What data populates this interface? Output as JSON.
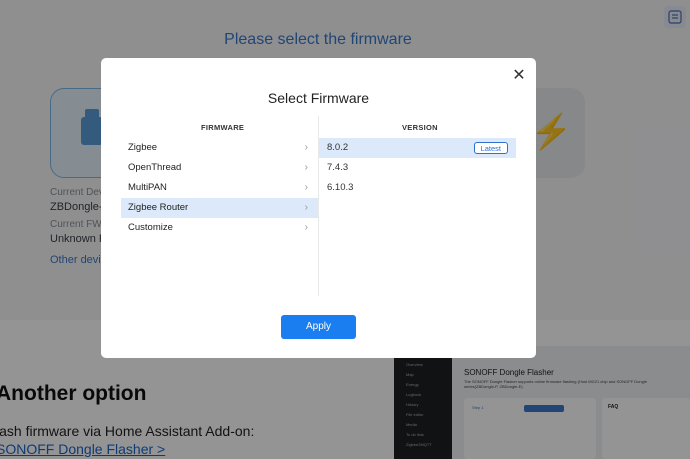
{
  "background": {
    "title": "Please select the firmware",
    "device_label": "Current Devic",
    "device_value": "ZBDongle-E",
    "fw_label": "Current FW:",
    "fw_value": "Unknown F",
    "other_device_link": "Other devic",
    "section_heading": "Another option",
    "section_text": "lash firmware via Home Assistant Add-on:",
    "section_link": "SONOFF Dongle Flasher >",
    "thumbnail": {
      "title": "SONOFF Dongle Flasher",
      "subtitle": "The SONOFF Dongle Flasher supports online firmware flashing (Host MG21 chip and SONOFF Dongle series(ZBDongle-P, ZBDongle-E).",
      "step": "Step 1",
      "faq": "FAQ",
      "sidebar_items": [
        "Overview",
        "Map",
        "Energy",
        "Logbook",
        "History",
        "File editor",
        "Media",
        "To do lists",
        "Zigbee2MQTT"
      ]
    }
  },
  "modal": {
    "title": "Select Firmware",
    "firmware_header": "FIRMWARE",
    "version_header": "VERSION",
    "firmware_items": [
      {
        "label": "Zigbee"
      },
      {
        "label": "OpenThread"
      },
      {
        "label": "MultiPAN"
      },
      {
        "label": "Zigbee Router"
      },
      {
        "label": "Customize"
      }
    ],
    "selected_firmware": "Zigbee Router",
    "versions": [
      {
        "label": "8.0.2",
        "badge": "Latest"
      },
      {
        "label": "7.4.3"
      },
      {
        "label": "6.10.3"
      }
    ],
    "selected_version": "8.0.2",
    "apply_label": "Apply",
    "close_icon": "close-icon"
  },
  "colors": {
    "accent": "#1a7ef0",
    "selection": "#dbe9fb",
    "link": "#3a78c8"
  }
}
